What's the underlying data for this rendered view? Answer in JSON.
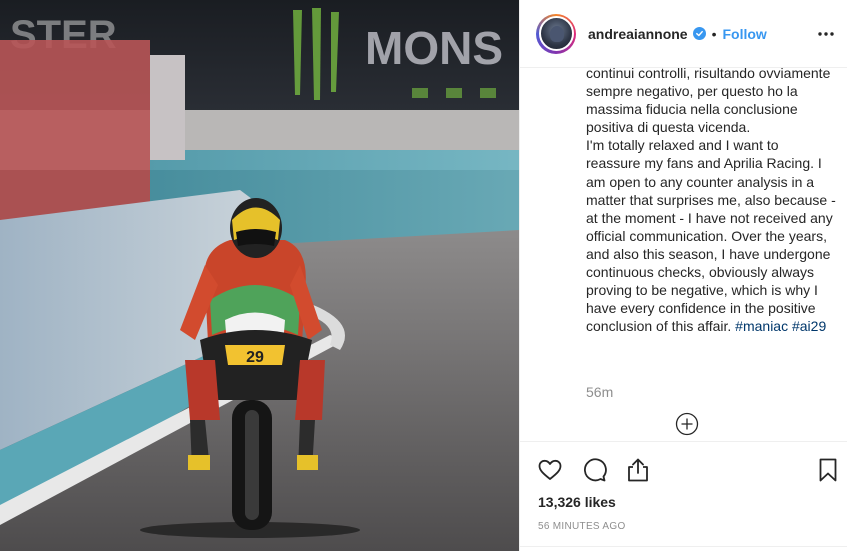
{
  "post": {
    "image_alt": "Aprilia Racing rider number 29 in the pit lane",
    "image_texts": [
      "STER",
      "MONS"
    ]
  },
  "header": {
    "username": "andreaiannone",
    "separator": "•",
    "follow_label": "Follow"
  },
  "caption": {
    "text": "continui controlli, risultando ovviamente sempre negativo, per questo ho la massima fiducia nella conclusione positiva di questa vicenda.\nI'm totally relaxed and I want to reassure my fans and Aprilia Racing. I am open to any counter analysis in a matter that surprises me, also because - at the moment - I have not received any official communication. Over the years, and also this season, I have undergone continuous checks, obviously always proving to be negative, which is why I have every confidence in the positive conclusion of this affair. ",
    "hashtags": [
      "#maniac",
      "#ai29"
    ],
    "timestamp_short": "56m"
  },
  "actions": {
    "icons": [
      "heart-icon",
      "comment-icon",
      "share-icon",
      "bookmark-icon",
      "plus-circle-icon",
      "more-icon",
      "verified-icon"
    ]
  },
  "stats": {
    "likes": "13,326 likes",
    "time_ago": "56 minutes ago"
  },
  "colors": {
    "link_blue": "#3897f0",
    "hashtag": "#00376b",
    "muted": "#8e8e8e",
    "text": "#262626"
  }
}
